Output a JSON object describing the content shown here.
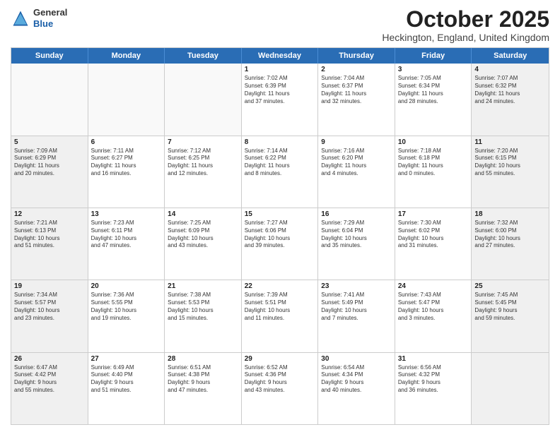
{
  "header": {
    "logo_line1": "General",
    "logo_line2": "Blue",
    "month_title": "October 2025",
    "location": "Heckington, England, United Kingdom"
  },
  "days_of_week": [
    "Sunday",
    "Monday",
    "Tuesday",
    "Wednesday",
    "Thursday",
    "Friday",
    "Saturday"
  ],
  "rows": [
    [
      {
        "day": "",
        "text": "",
        "empty": true
      },
      {
        "day": "",
        "text": "",
        "empty": true
      },
      {
        "day": "",
        "text": "",
        "empty": true
      },
      {
        "day": "1",
        "text": "Sunrise: 7:02 AM\nSunset: 6:39 PM\nDaylight: 11 hours\nand 37 minutes.",
        "empty": false
      },
      {
        "day": "2",
        "text": "Sunrise: 7:04 AM\nSunset: 6:37 PM\nDaylight: 11 hours\nand 32 minutes.",
        "empty": false
      },
      {
        "day": "3",
        "text": "Sunrise: 7:05 AM\nSunset: 6:34 PM\nDaylight: 11 hours\nand 28 minutes.",
        "empty": false
      },
      {
        "day": "4",
        "text": "Sunrise: 7:07 AM\nSunset: 6:32 PM\nDaylight: 11 hours\nand 24 minutes.",
        "empty": false,
        "shaded": true
      }
    ],
    [
      {
        "day": "5",
        "text": "Sunrise: 7:09 AM\nSunset: 6:29 PM\nDaylight: 11 hours\nand 20 minutes.",
        "empty": false,
        "shaded": true
      },
      {
        "day": "6",
        "text": "Sunrise: 7:11 AM\nSunset: 6:27 PM\nDaylight: 11 hours\nand 16 minutes.",
        "empty": false
      },
      {
        "day": "7",
        "text": "Sunrise: 7:12 AM\nSunset: 6:25 PM\nDaylight: 11 hours\nand 12 minutes.",
        "empty": false
      },
      {
        "day": "8",
        "text": "Sunrise: 7:14 AM\nSunset: 6:22 PM\nDaylight: 11 hours\nand 8 minutes.",
        "empty": false
      },
      {
        "day": "9",
        "text": "Sunrise: 7:16 AM\nSunset: 6:20 PM\nDaylight: 11 hours\nand 4 minutes.",
        "empty": false
      },
      {
        "day": "10",
        "text": "Sunrise: 7:18 AM\nSunset: 6:18 PM\nDaylight: 11 hours\nand 0 minutes.",
        "empty": false
      },
      {
        "day": "11",
        "text": "Sunrise: 7:20 AM\nSunset: 6:15 PM\nDaylight: 10 hours\nand 55 minutes.",
        "empty": false,
        "shaded": true
      }
    ],
    [
      {
        "day": "12",
        "text": "Sunrise: 7:21 AM\nSunset: 6:13 PM\nDaylight: 10 hours\nand 51 minutes.",
        "empty": false,
        "shaded": true
      },
      {
        "day": "13",
        "text": "Sunrise: 7:23 AM\nSunset: 6:11 PM\nDaylight: 10 hours\nand 47 minutes.",
        "empty": false
      },
      {
        "day": "14",
        "text": "Sunrise: 7:25 AM\nSunset: 6:09 PM\nDaylight: 10 hours\nand 43 minutes.",
        "empty": false
      },
      {
        "day": "15",
        "text": "Sunrise: 7:27 AM\nSunset: 6:06 PM\nDaylight: 10 hours\nand 39 minutes.",
        "empty": false
      },
      {
        "day": "16",
        "text": "Sunrise: 7:29 AM\nSunset: 6:04 PM\nDaylight: 10 hours\nand 35 minutes.",
        "empty": false
      },
      {
        "day": "17",
        "text": "Sunrise: 7:30 AM\nSunset: 6:02 PM\nDaylight: 10 hours\nand 31 minutes.",
        "empty": false
      },
      {
        "day": "18",
        "text": "Sunrise: 7:32 AM\nSunset: 6:00 PM\nDaylight: 10 hours\nand 27 minutes.",
        "empty": false,
        "shaded": true
      }
    ],
    [
      {
        "day": "19",
        "text": "Sunrise: 7:34 AM\nSunset: 5:57 PM\nDaylight: 10 hours\nand 23 minutes.",
        "empty": false,
        "shaded": true
      },
      {
        "day": "20",
        "text": "Sunrise: 7:36 AM\nSunset: 5:55 PM\nDaylight: 10 hours\nand 19 minutes.",
        "empty": false
      },
      {
        "day": "21",
        "text": "Sunrise: 7:38 AM\nSunset: 5:53 PM\nDaylight: 10 hours\nand 15 minutes.",
        "empty": false
      },
      {
        "day": "22",
        "text": "Sunrise: 7:39 AM\nSunset: 5:51 PM\nDaylight: 10 hours\nand 11 minutes.",
        "empty": false
      },
      {
        "day": "23",
        "text": "Sunrise: 7:41 AM\nSunset: 5:49 PM\nDaylight: 10 hours\nand 7 minutes.",
        "empty": false
      },
      {
        "day": "24",
        "text": "Sunrise: 7:43 AM\nSunset: 5:47 PM\nDaylight: 10 hours\nand 3 minutes.",
        "empty": false
      },
      {
        "day": "25",
        "text": "Sunrise: 7:45 AM\nSunset: 5:45 PM\nDaylight: 9 hours\nand 59 minutes.",
        "empty": false,
        "shaded": true
      }
    ],
    [
      {
        "day": "26",
        "text": "Sunrise: 6:47 AM\nSunset: 4:42 PM\nDaylight: 9 hours\nand 55 minutes.",
        "empty": false,
        "shaded": true
      },
      {
        "day": "27",
        "text": "Sunrise: 6:49 AM\nSunset: 4:40 PM\nDaylight: 9 hours\nand 51 minutes.",
        "empty": false
      },
      {
        "day": "28",
        "text": "Sunrise: 6:51 AM\nSunset: 4:38 PM\nDaylight: 9 hours\nand 47 minutes.",
        "empty": false
      },
      {
        "day": "29",
        "text": "Sunrise: 6:52 AM\nSunset: 4:36 PM\nDaylight: 9 hours\nand 43 minutes.",
        "empty": false
      },
      {
        "day": "30",
        "text": "Sunrise: 6:54 AM\nSunset: 4:34 PM\nDaylight: 9 hours\nand 40 minutes.",
        "empty": false
      },
      {
        "day": "31",
        "text": "Sunrise: 6:56 AM\nSunset: 4:32 PM\nDaylight: 9 hours\nand 36 minutes.",
        "empty": false
      },
      {
        "day": "",
        "text": "",
        "empty": true,
        "shaded": true
      }
    ]
  ]
}
